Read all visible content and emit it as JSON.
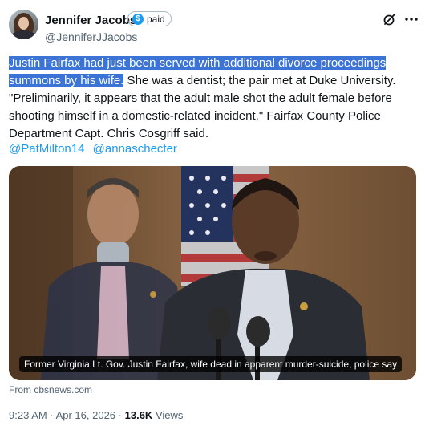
{
  "author": {
    "name": "Jennifer Jacobs",
    "badge_label": "paid",
    "badge_symbol": "$",
    "handle": "@JenniferJJacobs"
  },
  "actions": {
    "grok_icon": "slash-circle-icon",
    "more_icon": "more-icon"
  },
  "post": {
    "highlighted_text": "Justin Fairfax had just been served with additional divorce proceedings summons by his wife.",
    "body_text": " She was a dentist; the pair met at Duke University. \"Preliminarily, it appears that the adult male shot the adult female before shooting himself in a domestic-related incident,\" Fairfax County Police Department Capt. Chris Cosgriff said.",
    "mentions": [
      "@PatMilton14",
      "@annaschecter"
    ]
  },
  "card": {
    "caption": "Former Virginia Lt. Gov. Justin Fairfax, wife dead in apparent murder-suicide, police say",
    "source": "From cbsnews.com"
  },
  "meta": {
    "time": "9:23 AM",
    "separator": "·",
    "date": "Apr 16, 2026",
    "views_count": "13.6K",
    "views_label": "Views"
  },
  "colors": {
    "accent": "#1d9bf0",
    "highlight": "#3b73d6",
    "muted": "#536471"
  }
}
